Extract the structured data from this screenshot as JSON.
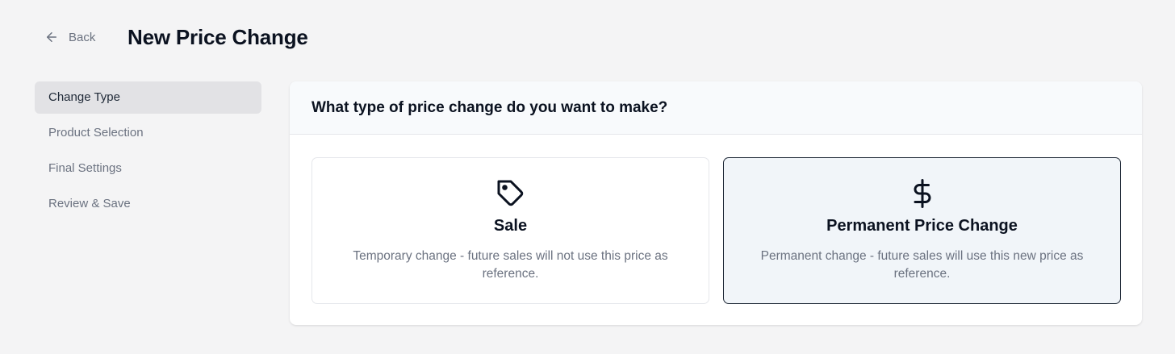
{
  "header": {
    "back_label": "Back",
    "title": "New Price Change"
  },
  "steps": [
    {
      "label": "Change Type",
      "active": true
    },
    {
      "label": "Product Selection",
      "active": false
    },
    {
      "label": "Final Settings",
      "active": false
    },
    {
      "label": "Review & Save",
      "active": false
    }
  ],
  "panel": {
    "question": "What type of price change do you want to make?",
    "options": [
      {
        "icon": "tag-icon",
        "title": "Sale",
        "description": "Temporary change - future sales will not use this price as reference.",
        "selected": false
      },
      {
        "icon": "dollar-icon",
        "title": "Permanent Price Change",
        "description": "Permanent change - future sales will use this new price as reference.",
        "selected": true
      }
    ]
  },
  "colors": {
    "background": "#f4f4f5",
    "active_step_bg": "#e2e2e5",
    "muted_text": "#6b7280",
    "selected_border": "#1f2937",
    "selected_bg": "#f1f5f9"
  }
}
